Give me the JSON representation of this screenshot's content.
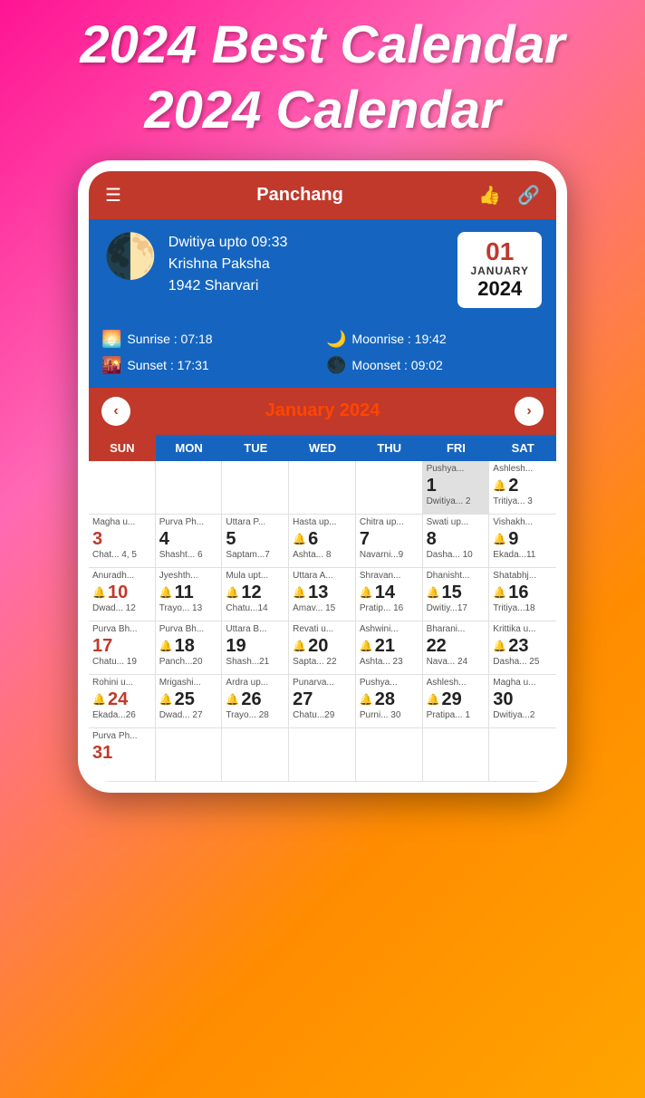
{
  "header": {
    "line1": "2024 Best Calendar",
    "line2": "2024 Calendar"
  },
  "appbar": {
    "title": "Panchang",
    "like_icon": "👍",
    "share_icon": "🔗"
  },
  "panchang": {
    "tithi": "Dwitiya upto 09:33",
    "paksha": "Krishna Paksha",
    "samvat": "1942 Sharvari",
    "date_day": "01",
    "date_month": "JANUARY",
    "date_year": "2024",
    "sunrise_label": "Sunrise : 07:18",
    "sunset_label": "Sunset : 17:31",
    "moonrise_label": "Moonrise : 19:42",
    "moonset_label": "Moonset : 09:02"
  },
  "calendar": {
    "month_label": "January",
    "year_label": "2024",
    "day_headers": [
      "SUN",
      "MON",
      "TUE",
      "WED",
      "THU",
      "FRI",
      "SAT"
    ],
    "rows": [
      {
        "cells": [
          {
            "empty": true
          },
          {
            "empty": true
          },
          {
            "empty": true
          },
          {
            "empty": true
          },
          {
            "empty": true
          },
          {
            "nakshatra": "Pushya...",
            "date": "1",
            "tithi": "Dwitiya... 2",
            "today": true,
            "color": "normal"
          },
          {
            "nakshatra": "Ashlesh...",
            "date": "2",
            "tithi": "Tritiya... 3",
            "color": "normal",
            "special": "🔔"
          }
        ]
      },
      {
        "cells": [
          {
            "nakshatra": "Magha u...",
            "date": "3",
            "tithi": "Chat... 4, 5",
            "color": "red"
          },
          {
            "nakshatra": "Purva Ph...",
            "date": "4",
            "tithi": "Shasht... 6",
            "color": "normal"
          },
          {
            "nakshatra": "Uttara P...",
            "date": "5",
            "tithi": "Saptam...7",
            "color": "normal"
          },
          {
            "nakshatra": "Hasta up...",
            "date": "6",
            "tithi": "Ashta... 8",
            "color": "normal",
            "special": "🔔"
          },
          {
            "nakshatra": "Chitra up...",
            "date": "7",
            "tithi": "Navarni...9",
            "color": "normal"
          },
          {
            "nakshatra": "Swati up...",
            "date": "8",
            "tithi": "Dasha... 10",
            "color": "normal"
          },
          {
            "nakshatra": "Vishakh...",
            "date": "9",
            "tithi": "Ekada...11",
            "color": "normal",
            "special": "🔔"
          }
        ]
      },
      {
        "cells": [
          {
            "nakshatra": "Anuradh...",
            "date": "10",
            "tithi": "Dwad... 12",
            "color": "red",
            "special": "🔔"
          },
          {
            "nakshatra": "Jyeshth...",
            "date": "11",
            "tithi": "Trayo... 13",
            "color": "normal",
            "special": "🔔"
          },
          {
            "nakshatra": "Mula upt...",
            "date": "12",
            "tithi": "Chatu...14",
            "color": "normal",
            "special": "🔔"
          },
          {
            "nakshatra": "Uttara A...",
            "date": "13",
            "tithi": "Amav... 15",
            "color": "normal",
            "special": "🔔"
          },
          {
            "nakshatra": "Shravan...",
            "date": "14",
            "tithi": "Pratip... 16",
            "color": "normal",
            "special": "🔔"
          },
          {
            "nakshatra": "Dhanisht...",
            "date": "15",
            "tithi": "Dwitiy...17",
            "color": "normal",
            "special": "🔔"
          },
          {
            "nakshatra": "Shatabhj...",
            "date": "16",
            "tithi": "Tritiya...18",
            "color": "normal",
            "special": "🔔"
          }
        ]
      },
      {
        "cells": [
          {
            "nakshatra": "Purva Bh...",
            "date": "17",
            "tithi": "Chatu... 19",
            "color": "red"
          },
          {
            "nakshatra": "Purva Bh...",
            "date": "18",
            "tithi": "Panch...20",
            "color": "normal",
            "special": "🔔"
          },
          {
            "nakshatra": "Uttara B...",
            "date": "19",
            "tithi": "Shash...21",
            "color": "normal"
          },
          {
            "nakshatra": "Revati u...",
            "date": "20",
            "tithi": "Sapta... 22",
            "color": "normal",
            "special": "🔔"
          },
          {
            "nakshatra": "Ashwini...",
            "date": "21",
            "tithi": "Ashta... 23",
            "color": "normal",
            "special": "🔔"
          },
          {
            "nakshatra": "Bharani...",
            "date": "22",
            "tithi": "Nava... 24",
            "color": "normal"
          },
          {
            "nakshatra": "Krittika u...",
            "date": "23",
            "tithi": "Dasha... 25",
            "color": "normal",
            "special": "🔔"
          }
        ]
      },
      {
        "cells": [
          {
            "nakshatra": "Rohini u...",
            "date": "24",
            "tithi": "Ekada...26",
            "color": "red",
            "special": "🔔"
          },
          {
            "nakshatra": "Mrigashi...",
            "date": "25",
            "tithi": "Dwad... 27",
            "color": "normal",
            "special": "🔔"
          },
          {
            "nakshatra": "Ardra up...",
            "date": "26",
            "tithi": "Trayo... 28",
            "color": "normal",
            "special": "🔔"
          },
          {
            "nakshatra": "Punarva...",
            "date": "27",
            "tithi": "Chatu...29",
            "color": "normal"
          },
          {
            "nakshatra": "Pushya...",
            "date": "28",
            "tithi": "Purni... 30",
            "color": "normal",
            "special": "🔔"
          },
          {
            "nakshatra": "Ashlesh...",
            "date": "29",
            "tithi": "Pratipa... 1",
            "color": "normal",
            "special": "🔔"
          },
          {
            "nakshatra": "Magha u...",
            "date": "30",
            "tithi": "Dwitiya...2",
            "color": "normal"
          }
        ]
      },
      {
        "cells": [
          {
            "nakshatra": "Purva Ph...",
            "date": "31",
            "tithi": "",
            "color": "red"
          },
          {
            "empty": true
          },
          {
            "empty": true
          },
          {
            "empty": true
          },
          {
            "empty": true
          },
          {
            "empty": true
          },
          {
            "empty": true
          }
        ]
      }
    ]
  }
}
